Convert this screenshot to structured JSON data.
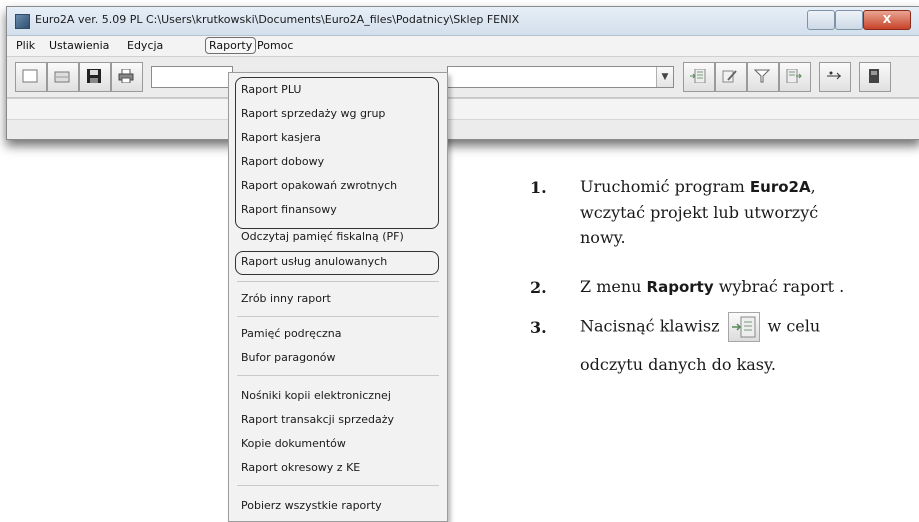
{
  "window": {
    "title": "Euro2A ver. 5.09 PL  C:\\Users\\krutkowski\\Documents\\Euro2A_files\\Podatnicy\\Sklep FENIX",
    "close_label": "X"
  },
  "menubar": {
    "items": [
      "Plik",
      "Ustawienia",
      "Edycja",
      "Raporty",
      "Pomoc"
    ]
  },
  "dropdown": {
    "items": [
      "Raport PLU",
      "Raport sprzedaży wg grup",
      "Raport kasjera",
      "Raport dobowy",
      "Raport opakowań zwrotnych",
      "Raport finansowy",
      "Odczytaj pamięć fiskalną (PF)",
      "Raport usług anulowanych",
      "Zrób inny raport",
      "Pamięć podręczna",
      "Bufor paragonów",
      "Nośniki kopii elektronicznej",
      "Raport transakcji sprzedaży",
      "Kopie dokumentów",
      "Raport okresowy z KE",
      "Pobierz wszystkie raporty"
    ]
  },
  "instructions": {
    "step1_num": "1.",
    "step1_a": "Uruchomić program ",
    "step1_b": "Euro2A",
    "step1_c": ",",
    "step1_line2": "wczytać projekt lub utworzyć",
    "step1_line3": "nowy.",
    "step2_num": "2.",
    "step2_a": "Z menu ",
    "step2_b": "Raporty",
    "step2_c": " wybrać raport .",
    "step3_num": "3.",
    "step3_a": "Nacisnąć klawisz",
    "step3_b": "w celu",
    "step3_line2": "odczytu danych do kasy."
  },
  "colors": {
    "accent_close": "#c7432a",
    "title_bar": "#d3dfec"
  }
}
